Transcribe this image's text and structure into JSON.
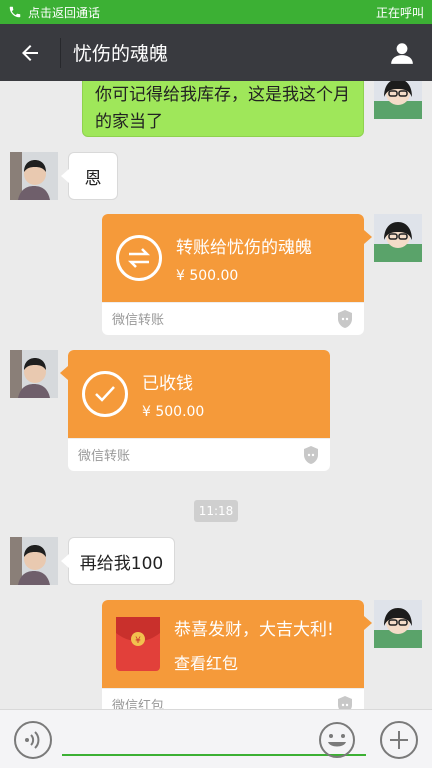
{
  "call_banner": {
    "left_text": "点击返回通话",
    "right_text": "正在呼叫"
  },
  "header": {
    "title": "忧伤的魂魄"
  },
  "messages": [
    {
      "type": "text",
      "from": "me",
      "text": "你可记得给我库存，这是我这个月的家当了"
    },
    {
      "type": "text",
      "from": "friend",
      "text": "恩"
    },
    {
      "type": "transfer",
      "from": "me",
      "title": "转账给忧伤的魂魄",
      "amount": "¥ 500.00",
      "footer": "微信转账"
    },
    {
      "type": "transfer",
      "from": "friend",
      "title": "已收钱",
      "amount": "¥ 500.00",
      "footer": "微信转账"
    },
    {
      "type": "time",
      "text": "11:18"
    },
    {
      "type": "text",
      "from": "friend",
      "text": "再给我100"
    },
    {
      "type": "redpacket",
      "from": "me",
      "title": "恭喜发财，大吉大利!",
      "subtitle": "查看红包",
      "footer": "微信红包"
    }
  ],
  "colors": {
    "banner": "#3cb034",
    "header": "#393a3f",
    "my_bubble": "#9fe75a",
    "card_orange": "#f59a3a",
    "red_packet": "#e2403a"
  }
}
